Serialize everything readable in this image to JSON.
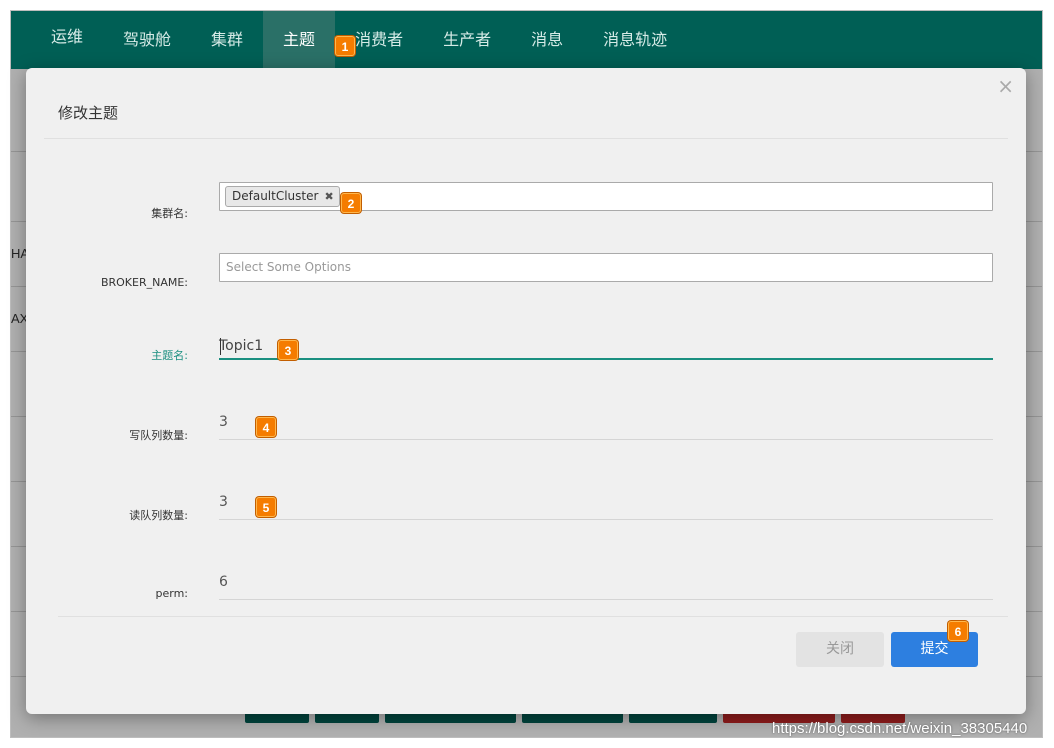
{
  "nav": {
    "items": [
      {
        "label": "运维"
      },
      {
        "label": "驾驶舱"
      },
      {
        "label": "集群"
      },
      {
        "label": "主题"
      },
      {
        "label": "消费者"
      },
      {
        "label": "生产者"
      },
      {
        "label": "消息"
      },
      {
        "label": "消息轨迹"
      }
    ],
    "active": "主题"
  },
  "background": {
    "partial_text_1": "HA",
    "partial_text_2": "AX"
  },
  "modal": {
    "title": "修改主题",
    "close_icon": "close-icon",
    "fields": {
      "cluster": {
        "label": "集群名:",
        "tag": "DefaultCluster"
      },
      "broker": {
        "label": "BROKER_NAME:",
        "placeholder": "Select Some Options"
      },
      "topic": {
        "label": "主题名:",
        "value": "Topic1"
      },
      "write_queue": {
        "label": "写队列数量:",
        "value": "3"
      },
      "read_queue": {
        "label": "读队列数量:",
        "value": "3"
      },
      "perm": {
        "label": "perm:",
        "value": "6"
      }
    },
    "buttons": {
      "close": "关闭",
      "submit": "提交"
    }
  },
  "badges": [
    "1",
    "2",
    "3",
    "4",
    "5",
    "6"
  ],
  "watermark": "https://blog.csdn.net/weixin_38305440",
  "colors": {
    "nav_bg": "#005f55",
    "accent_teal": "#1a8f80",
    "submit_blue": "#2d7fe0",
    "badge_orange": "#f57c00"
  }
}
